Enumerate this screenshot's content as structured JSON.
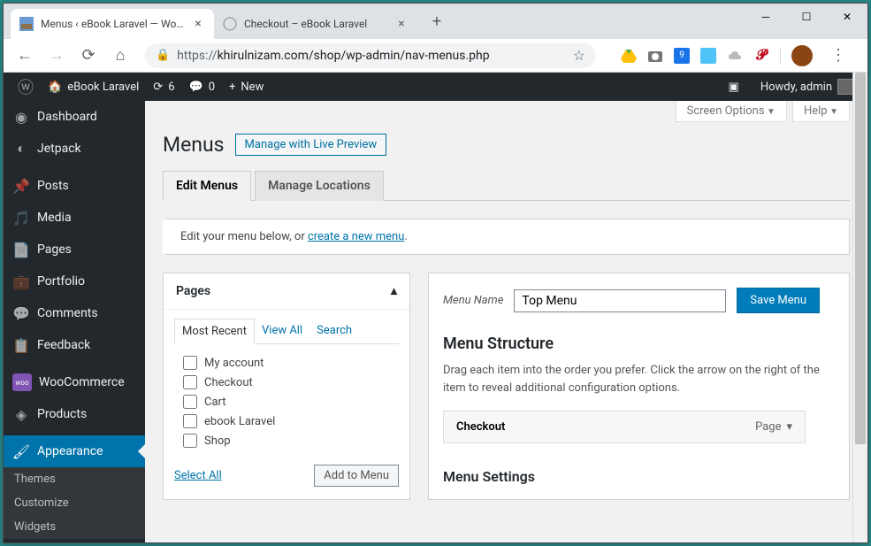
{
  "browser": {
    "tabs": [
      {
        "title": "Menus ‹ eBook Laravel — WordP"
      },
      {
        "title": "Checkout – eBook Laravel"
      }
    ],
    "url_prefix": "https://",
    "url_rest": "khirulnizam.com/shop/wp-admin/nav-menus.php"
  },
  "adminbar": {
    "site_name": "eBook Laravel",
    "updates_count": "6",
    "comments_count": "0",
    "new_label": "New",
    "howdy": "Howdy, admin"
  },
  "sidebar": {
    "items": [
      {
        "label": "Dashboard"
      },
      {
        "label": "Jetpack"
      },
      {
        "label": "Posts"
      },
      {
        "label": "Media"
      },
      {
        "label": "Pages"
      },
      {
        "label": "Portfolio"
      },
      {
        "label": "Comments"
      },
      {
        "label": "Feedback"
      },
      {
        "label": "WooCommerce"
      },
      {
        "label": "Products"
      },
      {
        "label": "Appearance"
      }
    ],
    "submenu": [
      "Themes",
      "Customize",
      "Widgets"
    ]
  },
  "screen_meta": {
    "screen_options": "Screen Options",
    "help": "Help"
  },
  "page": {
    "title": "Menus",
    "title_action": "Manage with Live Preview",
    "tab_edit": "Edit Menus",
    "tab_locations": "Manage Locations",
    "notice_before": "Edit your menu below, or ",
    "notice_link": "create a new menu",
    "notice_after": "."
  },
  "metabox": {
    "title": "Pages",
    "tab_recent": "Most Recent",
    "tab_all": "View All",
    "tab_search": "Search",
    "items": [
      "My account",
      "Checkout",
      "Cart",
      "ebook Laravel",
      "Shop"
    ],
    "select_all": "Select All",
    "add_button": "Add to Menu"
  },
  "menu_edit": {
    "name_label": "Menu Name",
    "name_value": "Top Menu",
    "save_label": "Save Menu",
    "structure_title": "Menu Structure",
    "structure_desc": "Drag each item into the order you prefer. Click the arrow on the right of the item to reveal additional configuration options.",
    "item_label": "Checkout",
    "item_type": "Page",
    "settings_title": "Menu Settings"
  }
}
